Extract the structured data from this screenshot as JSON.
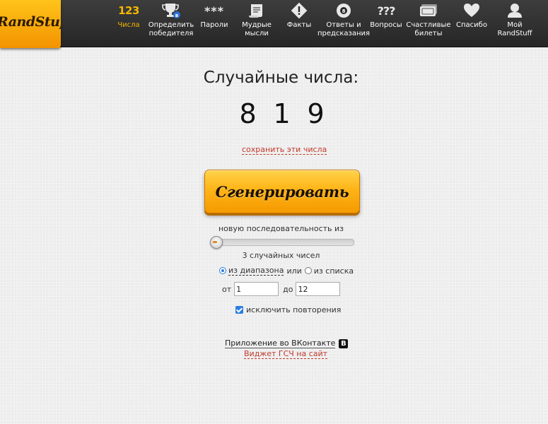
{
  "header": {
    "logo_text": "RandStuff",
    "nav": [
      {
        "icon": "numbers-icon",
        "icon_text": "123",
        "label": "Числа",
        "active": true
      },
      {
        "icon": "trophy-icon",
        "label": "Определить\nпобедителя"
      },
      {
        "icon": "password-icon",
        "icon_text": "***",
        "label": "Пароли"
      },
      {
        "icon": "scroll-icon",
        "label": "Мудрые\nмысли"
      },
      {
        "icon": "warning-icon",
        "label": "Факты"
      },
      {
        "icon": "magic-ball-icon",
        "label": "Ответы и\nпредсказания"
      },
      {
        "icon": "questions-icon",
        "icon_text": "???",
        "label": "Вопросы"
      },
      {
        "icon": "tickets-icon",
        "label": "Счастливые\nбилеты"
      },
      {
        "icon": "heart-icon",
        "label": "Спасибо"
      },
      {
        "icon": "user-icon",
        "label": "Мой\nRandStuff"
      }
    ]
  },
  "main": {
    "title": "Случайные числа:",
    "digits": [
      "8",
      "1",
      "9"
    ],
    "save_link": "сохранить эти числа",
    "generate_button": "Сгенерировать",
    "sequence_label": "новую последовательность из",
    "slider_value": 3,
    "count_label": "3 случайных чисел",
    "source": {
      "range_option": "из диапазона",
      "or_text": "или",
      "list_option": "из списка",
      "selected": "range"
    },
    "range": {
      "from_label": "от",
      "from_value": "1",
      "to_label": "до",
      "to_value": "12"
    },
    "exclude_repeats": {
      "label": "исключить повторения",
      "checked": true
    },
    "vk_link": "Приложение во ВКонтакте",
    "vk_badge": "B",
    "widget_link": "Виджет ГСЧ на сайт"
  },
  "colors": {
    "accent": "#f5b700",
    "link_red": "#c0392b",
    "button_orange": "#ffb417"
  }
}
